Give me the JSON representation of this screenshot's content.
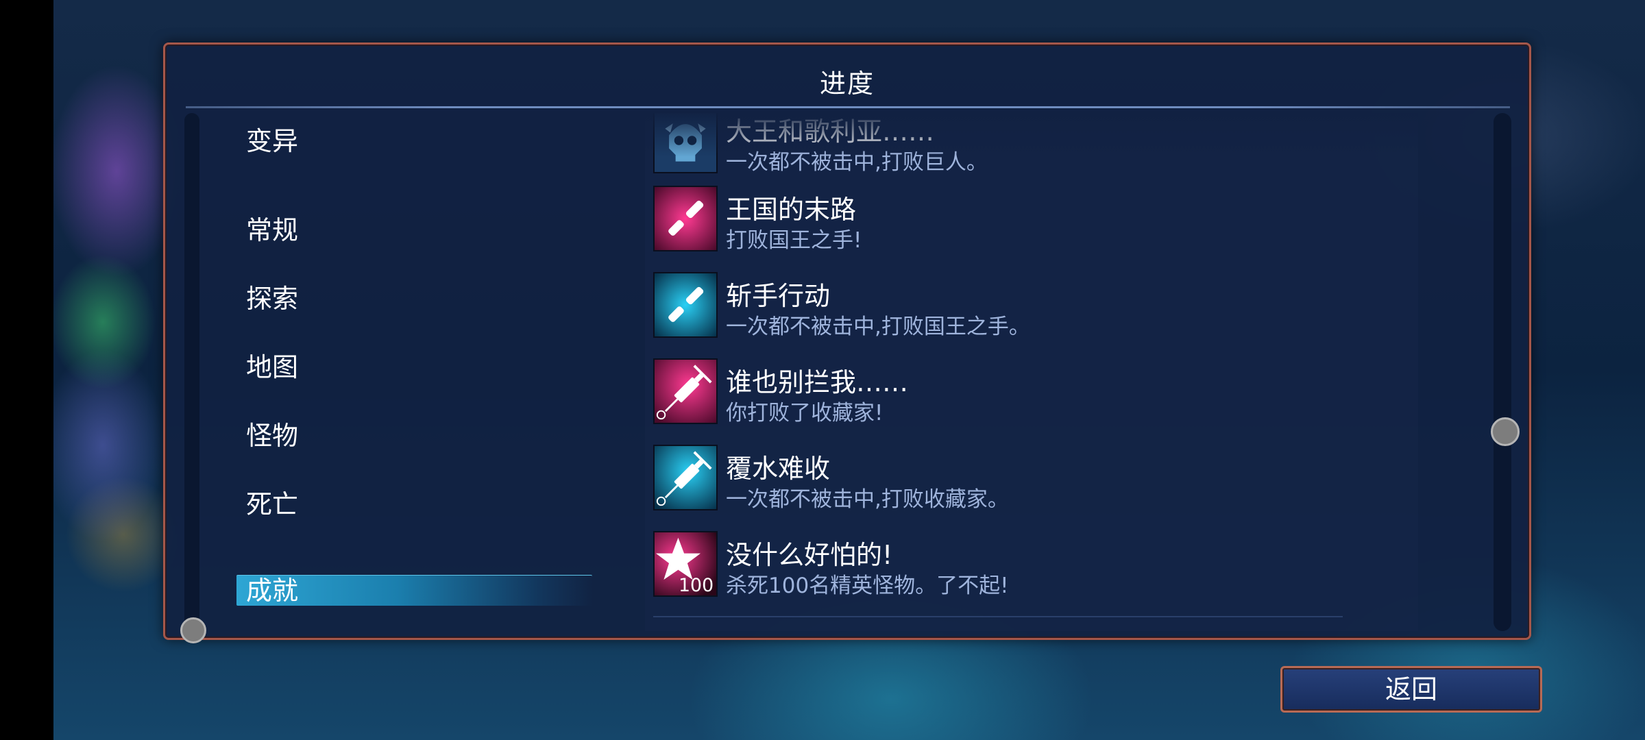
{
  "dialog": {
    "title": "进度"
  },
  "categories": [
    {
      "label": "变异",
      "selected": false
    },
    {
      "label": "常规",
      "selected": false
    },
    {
      "label": "探索",
      "selected": false
    },
    {
      "label": "地图",
      "selected": false
    },
    {
      "label": "怪物",
      "selected": false
    },
    {
      "label": "死亡",
      "selected": false
    },
    {
      "label": "成就",
      "selected": true
    }
  ],
  "achievements": [
    {
      "title": "大王和歌利亚……",
      "desc": "一次都不被击中,打败巨人。",
      "icon": "skull-icon",
      "color": "#5fb6e8"
    },
    {
      "title": "王国的末路",
      "desc": "打败国王之手!",
      "icon": "hand-icon",
      "color": "#e0116e"
    },
    {
      "title": "斩手行动",
      "desc": "一次都不被击中,打败国王之手。",
      "icon": "hand-icon",
      "color": "#14b7e0"
    },
    {
      "title": "谁也别拦我……",
      "desc": "你打败了收藏家!",
      "icon": "syringe-icon",
      "color": "#e0116e"
    },
    {
      "title": "覆水难收",
      "desc": "一次都不被击中,打败收藏家。",
      "icon": "syringe-icon",
      "color": "#14b7e0"
    },
    {
      "title": "没什么好怕的!",
      "desc": "杀死100名精英怪物。了不起!",
      "icon": "star-icon",
      "color": "#e0116e",
      "badge": "100"
    }
  ],
  "back_button": {
    "label": "返回"
  }
}
